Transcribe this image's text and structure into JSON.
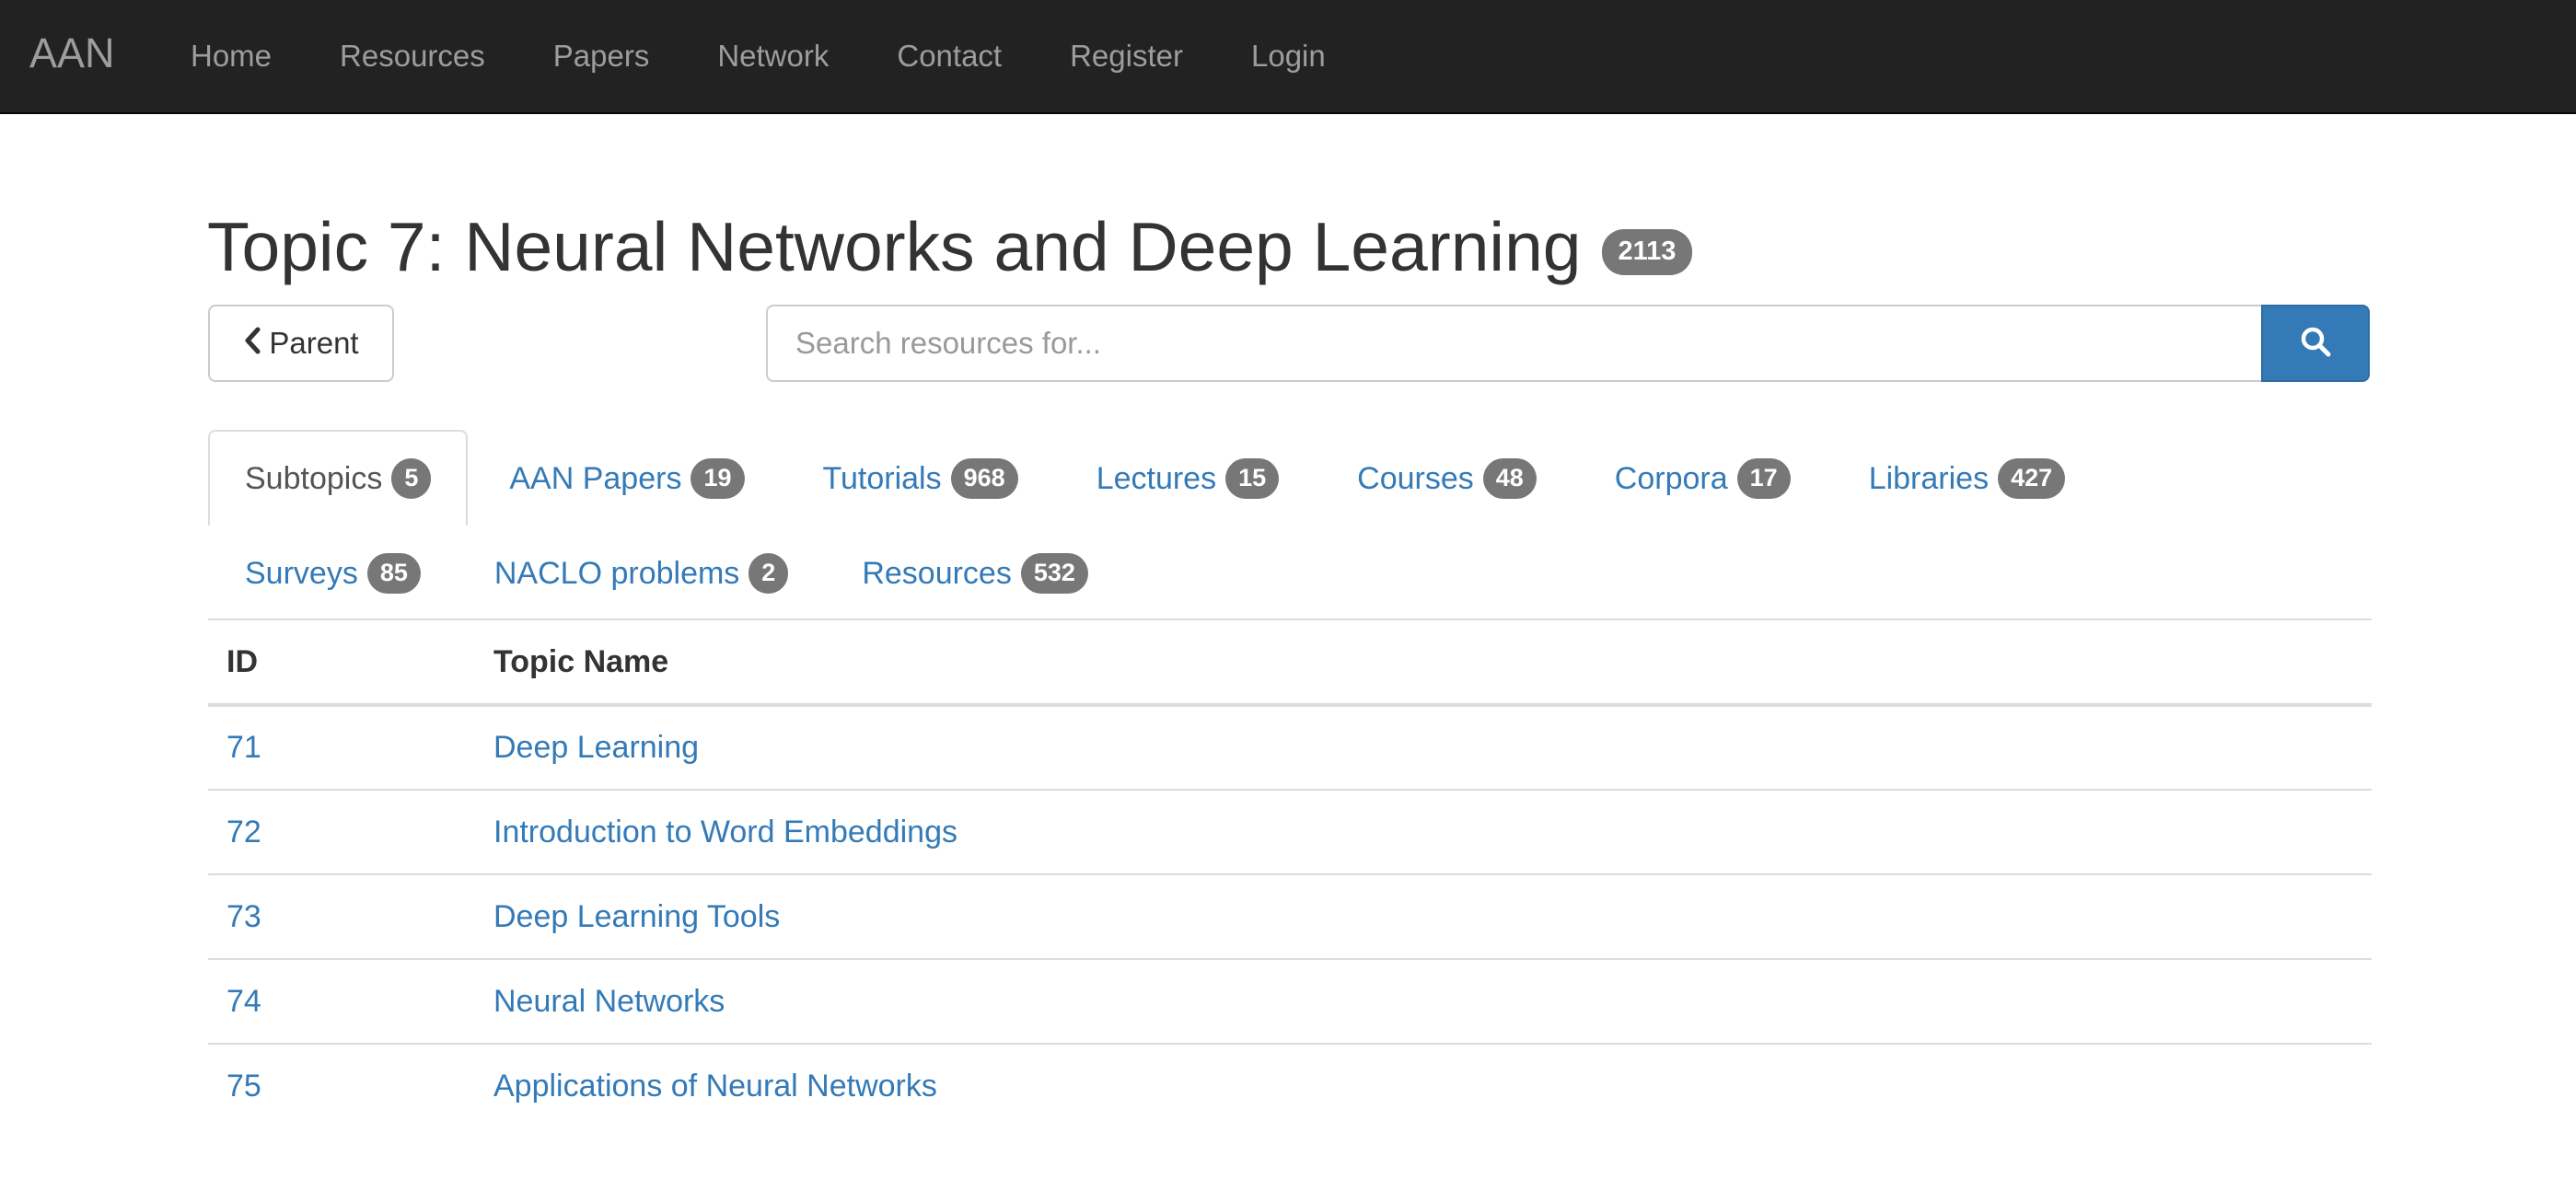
{
  "navbar": {
    "brand": "AAN",
    "links": [
      "Home",
      "Resources",
      "Papers",
      "Network",
      "Contact",
      "Register",
      "Login"
    ]
  },
  "header": {
    "title": "Topic 7: Neural Networks and Deep Learning",
    "count": "2113"
  },
  "parent_button": {
    "label": "Parent",
    "icon": "chevron-left-icon"
  },
  "search": {
    "placeholder": "Search resources for...",
    "value": "",
    "icon": "search-icon"
  },
  "tabs": [
    {
      "label": "Subtopics",
      "count": "5",
      "active": true
    },
    {
      "label": "AAN Papers",
      "count": "19"
    },
    {
      "label": "Tutorials",
      "count": "968"
    },
    {
      "label": "Lectures",
      "count": "15"
    },
    {
      "label": "Courses",
      "count": "48"
    },
    {
      "label": "Corpora",
      "count": "17"
    },
    {
      "label": "Libraries",
      "count": "427"
    },
    {
      "label": "Surveys",
      "count": "85"
    },
    {
      "label": "NACLO problems",
      "count": "2"
    },
    {
      "label": "Resources",
      "count": "532"
    }
  ],
  "table": {
    "headers": [
      "ID",
      "Topic Name"
    ],
    "rows": [
      {
        "id": "71",
        "name": "Deep Learning"
      },
      {
        "id": "72",
        "name": "Introduction to Word Embeddings"
      },
      {
        "id": "73",
        "name": "Deep Learning Tools"
      },
      {
        "id": "74",
        "name": "Neural Networks"
      },
      {
        "id": "75",
        "name": "Applications of Neural Networks"
      }
    ]
  },
  "colors": {
    "navbar_bg": "#222222",
    "nav_text": "#9d9d9d",
    "link": "#337ab7",
    "badge": "#777777",
    "primary_button": "#337ab7"
  }
}
